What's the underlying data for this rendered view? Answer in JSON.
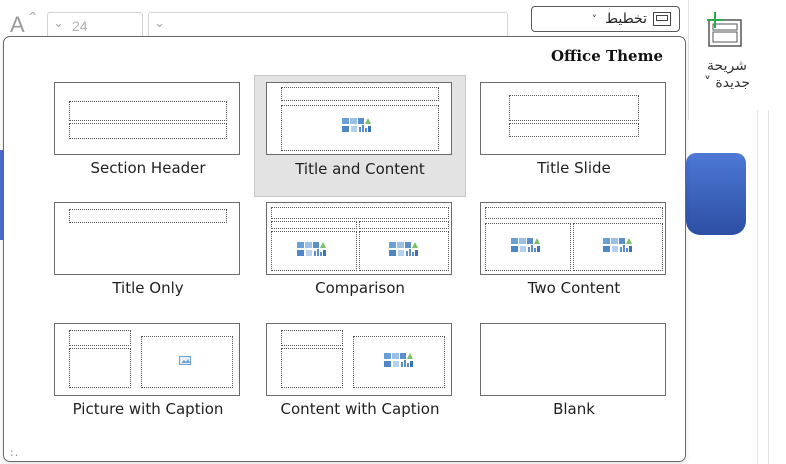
{
  "ribbon": {
    "font_grow_glyph": "A",
    "font_grow_caret": "^",
    "font_size_value": "24",
    "layout_label": "تخطيط",
    "new_slide_label_line1": "شريحة",
    "new_slide_label_line2": "جديدة ˅"
  },
  "gallery": {
    "title": "Office Theme",
    "selected": "Title and Content",
    "layouts": [
      {
        "label": "Section Header"
      },
      {
        "label": "Title and Content"
      },
      {
        "label": "Title Slide"
      },
      {
        "label": "Title Only"
      },
      {
        "label": "Comparison"
      },
      {
        "label": "Two Content"
      },
      {
        "label": "Picture with Caption"
      },
      {
        "label": "Content with Caption"
      },
      {
        "label": "Blank"
      }
    ],
    "resize_grip": ":."
  },
  "colors": {
    "selected_tile_bg": "#e3e3e3",
    "accent_blue": "#4d79d6",
    "new_slide_green": "#2ea84a"
  }
}
